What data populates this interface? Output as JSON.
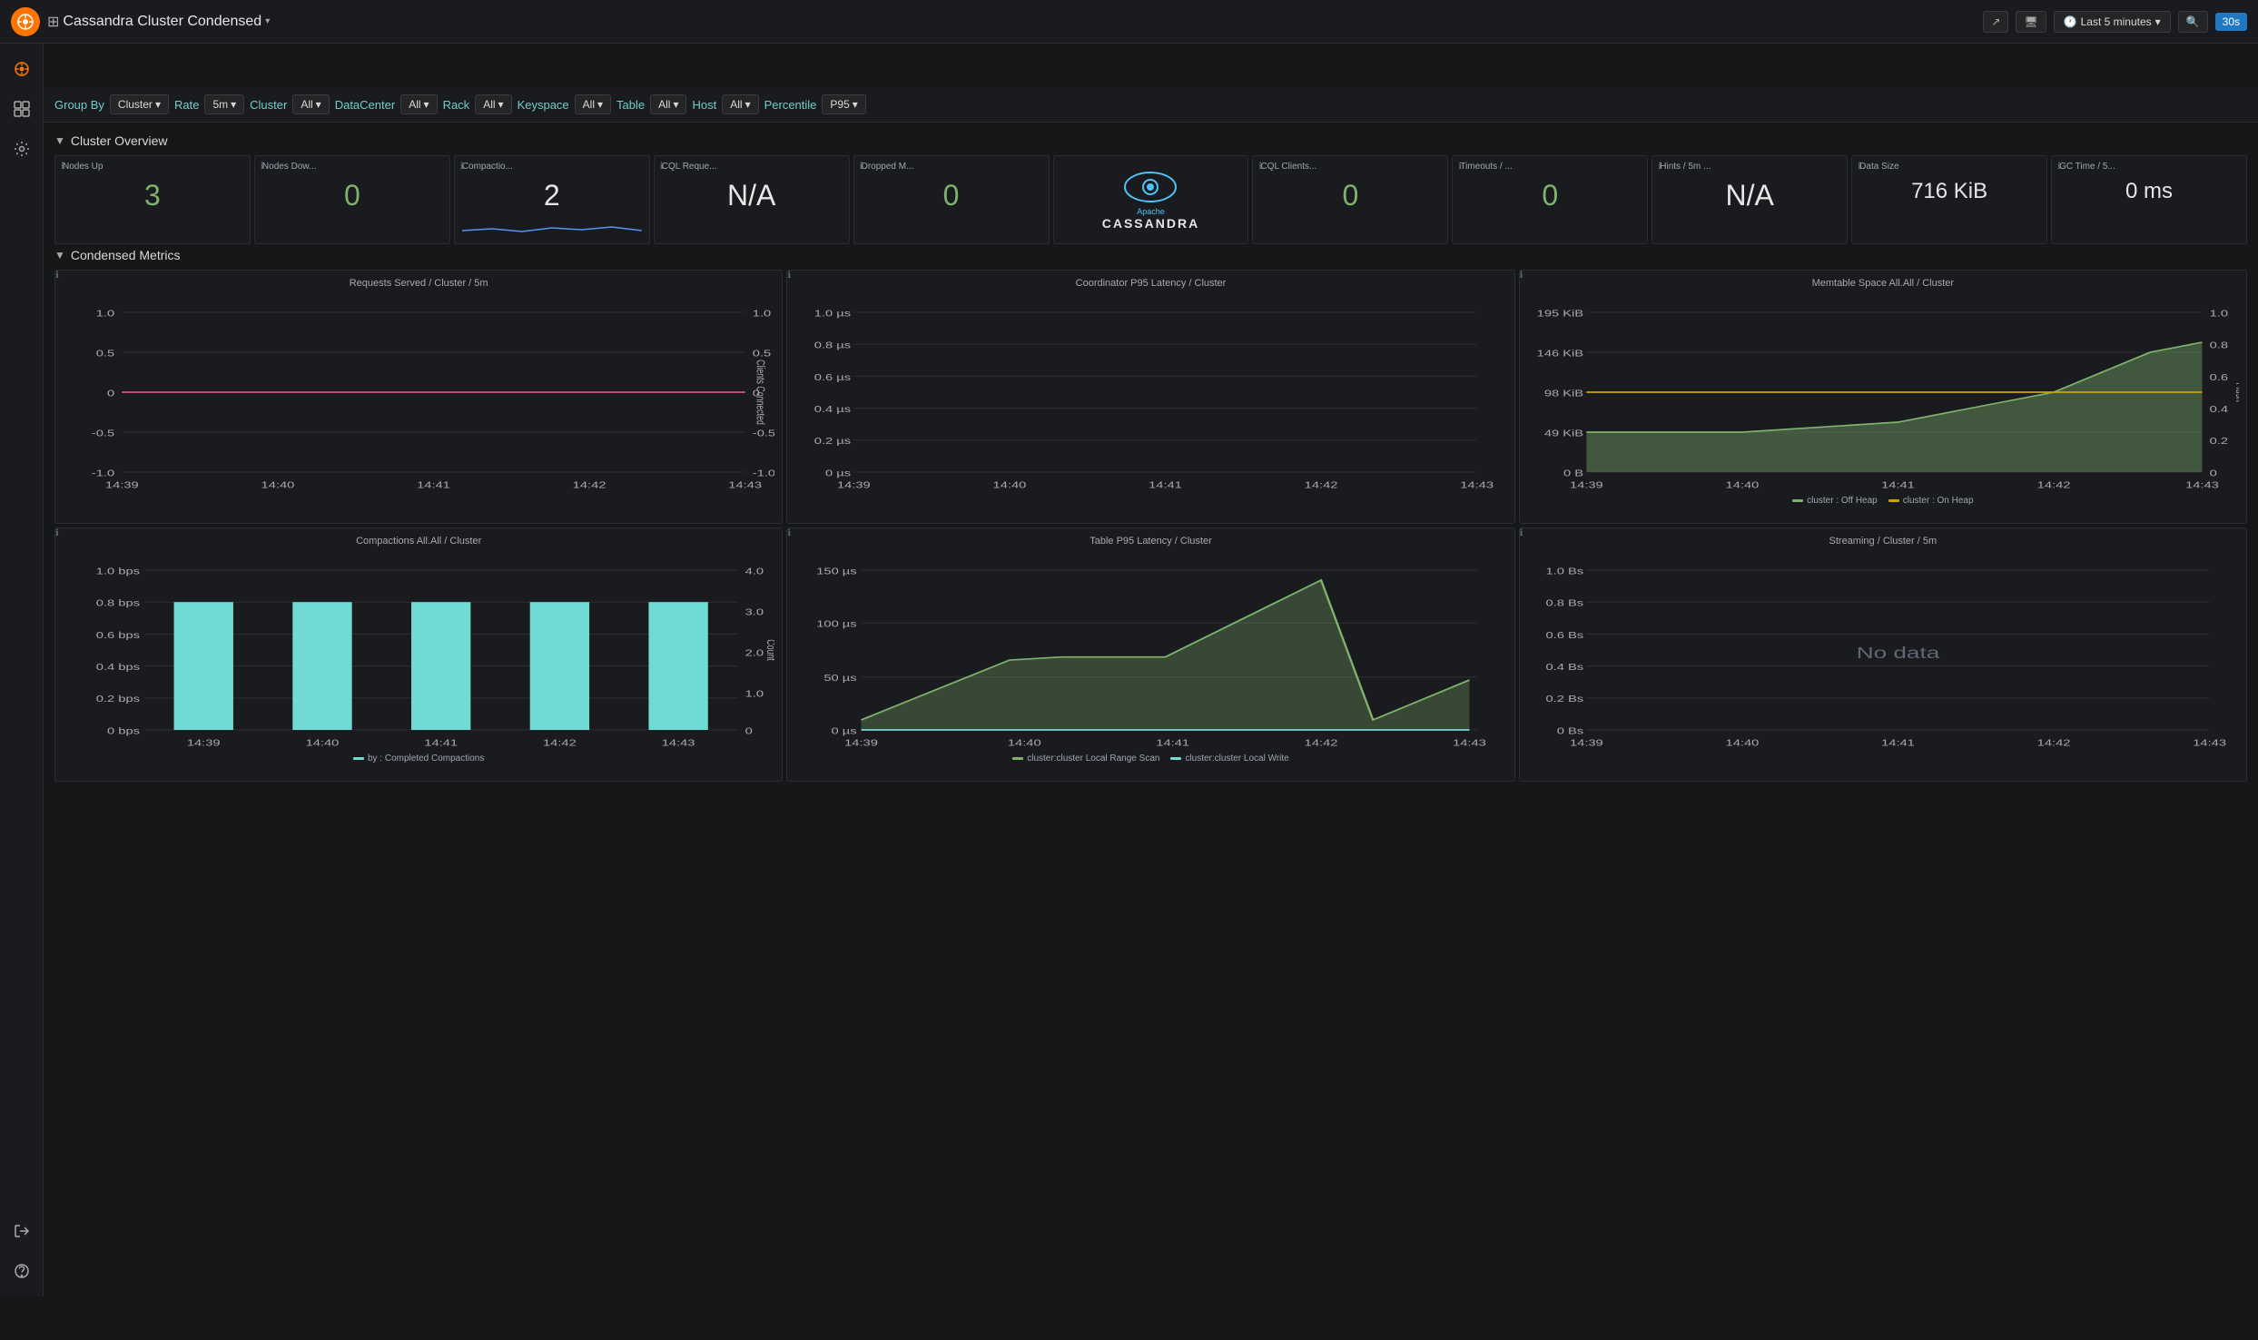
{
  "app": {
    "logo_symbol": "⬡",
    "title": "Cassandra Cluster Condensed",
    "title_arrow": "▾"
  },
  "nav": {
    "share_icon": "↗",
    "tv_icon": "⬛",
    "time_range": "Last 5 minutes",
    "time_arrow": "▾",
    "search_icon": "🔍",
    "refresh": "30s"
  },
  "sidebar": {
    "items": [
      {
        "label": "⊞",
        "name": "home"
      },
      {
        "label": "⊟",
        "name": "dashboards"
      },
      {
        "label": "⚙",
        "name": "settings"
      }
    ],
    "bottom_items": [
      {
        "label": "→",
        "name": "signin"
      },
      {
        "label": "?",
        "name": "help"
      }
    ]
  },
  "toolbar": {
    "group_by_label": "Group By",
    "group_by_value": "Cluster",
    "rate_label": "Rate",
    "rate_value": "5m",
    "cluster_label": "Cluster",
    "cluster_value": "All",
    "datacenter_label": "DataCenter",
    "datacenter_value": "All",
    "rack_label": "Rack",
    "rack_value": "All",
    "keyspace_label": "Keyspace",
    "keyspace_value": "All",
    "table_label": "Table",
    "table_value": "All",
    "host_label": "Host",
    "host_value": "All",
    "percentile_label": "Percentile",
    "percentile_value": "P95"
  },
  "cluster_overview": {
    "section_title": "Cluster Overview",
    "cards": [
      {
        "id": "nodes_up",
        "title": "Nodes Up",
        "value": "3",
        "value_class": "val-green",
        "has_sparkline": false
      },
      {
        "id": "nodes_down",
        "title": "Nodes Dow...",
        "value": "0",
        "value_class": "val-green",
        "has_sparkline": false
      },
      {
        "id": "compaction",
        "title": "Compactio...",
        "value": "2",
        "value_class": "val-white",
        "has_sparkline": true
      },
      {
        "id": "cql_requests",
        "title": "CQL Reque...",
        "value": "N/A",
        "value_class": "val-white",
        "has_sparkline": false
      },
      {
        "id": "dropped_m",
        "title": "Dropped M...",
        "value": "0",
        "value_class": "val-green",
        "has_sparkline": false
      },
      {
        "id": "cassandra_logo",
        "title": "",
        "value": "",
        "is_logo": true
      },
      {
        "id": "cql_clients",
        "title": "CQL Clients...",
        "value": "0",
        "value_class": "val-green",
        "has_sparkline": false
      },
      {
        "id": "timeouts",
        "title": "Timeouts / ...",
        "value": "0",
        "value_class": "val-green",
        "has_sparkline": false
      },
      {
        "id": "hints",
        "title": "Hints / 5m ...",
        "value": "N/A",
        "value_class": "val-white",
        "has_sparkline": false
      },
      {
        "id": "data_size",
        "title": "Data Size",
        "value": "716 KiB",
        "value_class": "val-white",
        "has_sparkline": false
      },
      {
        "id": "gc_time",
        "title": "GC Time / 5...",
        "value": "0 ms",
        "value_class": "val-white",
        "has_sparkline": false
      }
    ]
  },
  "condensed_metrics": {
    "section_title": "Condensed Metrics",
    "charts": [
      {
        "id": "requests_served",
        "title": "Requests Served / Cluster / 5m",
        "has_data": true,
        "y_left": [
          "1.0",
          "0.5",
          "0",
          "-0.5",
          "-1.0"
        ],
        "y_right": [
          "1.0",
          "0.5",
          "0",
          "-0.5",
          "-1.0"
        ],
        "x_labels": [
          "14:39",
          "14:40",
          "14:41",
          "14:42",
          "14:43"
        ],
        "right_axis_label": "Clients Connected",
        "type": "line_flat"
      },
      {
        "id": "coordinator_latency",
        "title": "Coordinator P95 Latency / Cluster",
        "has_data": true,
        "y_left": [
          "1.0 µs",
          "0.8 µs",
          "0.6 µs",
          "0.4 µs",
          "0.2 µs",
          "0 µs"
        ],
        "x_labels": [
          "14:39",
          "14:40",
          "14:41",
          "14:42",
          "14:43"
        ],
        "type": "line_empty"
      },
      {
        "id": "memtable_space",
        "title": "Memtable Space All.All / Cluster",
        "has_data": true,
        "y_left": [
          "195 KiB",
          "146 KiB",
          "98 KiB",
          "49 KiB",
          "0 B"
        ],
        "y_right": [
          "1.0",
          "0.8",
          "0.6",
          "0.4",
          "0.2",
          "0"
        ],
        "x_labels": [
          "14:39",
          "14:40",
          "14:41",
          "14:42",
          "14:43"
        ],
        "right_axis_label": "Flush",
        "type": "area_memtable",
        "legend": [
          {
            "label": "cluster : Off Heap",
            "color": "#7eb26d"
          },
          {
            "label": "cluster : On Heap",
            "color": "#cca300"
          }
        ]
      },
      {
        "id": "compactions",
        "title": "Compactions All.All / Cluster",
        "has_data": true,
        "y_left": [
          "1.0 bps",
          "0.8 bps",
          "0.6 bps",
          "0.4 bps",
          "0.2 bps",
          "0 bps"
        ],
        "y_right": [
          "4.0",
          "3.0",
          "2.0",
          "1.0",
          "0"
        ],
        "x_labels": [
          "14:39",
          "14:40",
          "14:41",
          "14:42",
          "14:43"
        ],
        "right_axis_label": "Count",
        "type": "bar_cyan",
        "legend": [
          {
            "label": "by : Completed Compactions",
            "color": "#70dbd4"
          }
        ]
      },
      {
        "id": "table_latency",
        "title": "Table P95 Latency / Cluster",
        "has_data": true,
        "y_left": [
          "150 µs",
          "100 µs",
          "50 µs",
          "0 µs"
        ],
        "x_labels": [
          "14:39",
          "14:40",
          "14:41",
          "14:42",
          "14:43"
        ],
        "type": "line_green_area",
        "legend": [
          {
            "label": "cluster:cluster Local Range Scan",
            "color": "#7eb26d"
          },
          {
            "label": "cluster:cluster Local Write",
            "color": "#70dbd4"
          }
        ]
      },
      {
        "id": "streaming",
        "title": "Streaming / Cluster / 5m",
        "has_data": false,
        "y_left": [
          "1.0 Bs",
          "0.8 Bs",
          "0.6 Bs",
          "0.4 Bs",
          "0.2 Bs",
          "0 Bs"
        ],
        "x_labels": [
          "14:39",
          "14:40",
          "14:41",
          "14:42",
          "14:43"
        ],
        "no_data_text": "No data",
        "type": "empty"
      }
    ]
  }
}
